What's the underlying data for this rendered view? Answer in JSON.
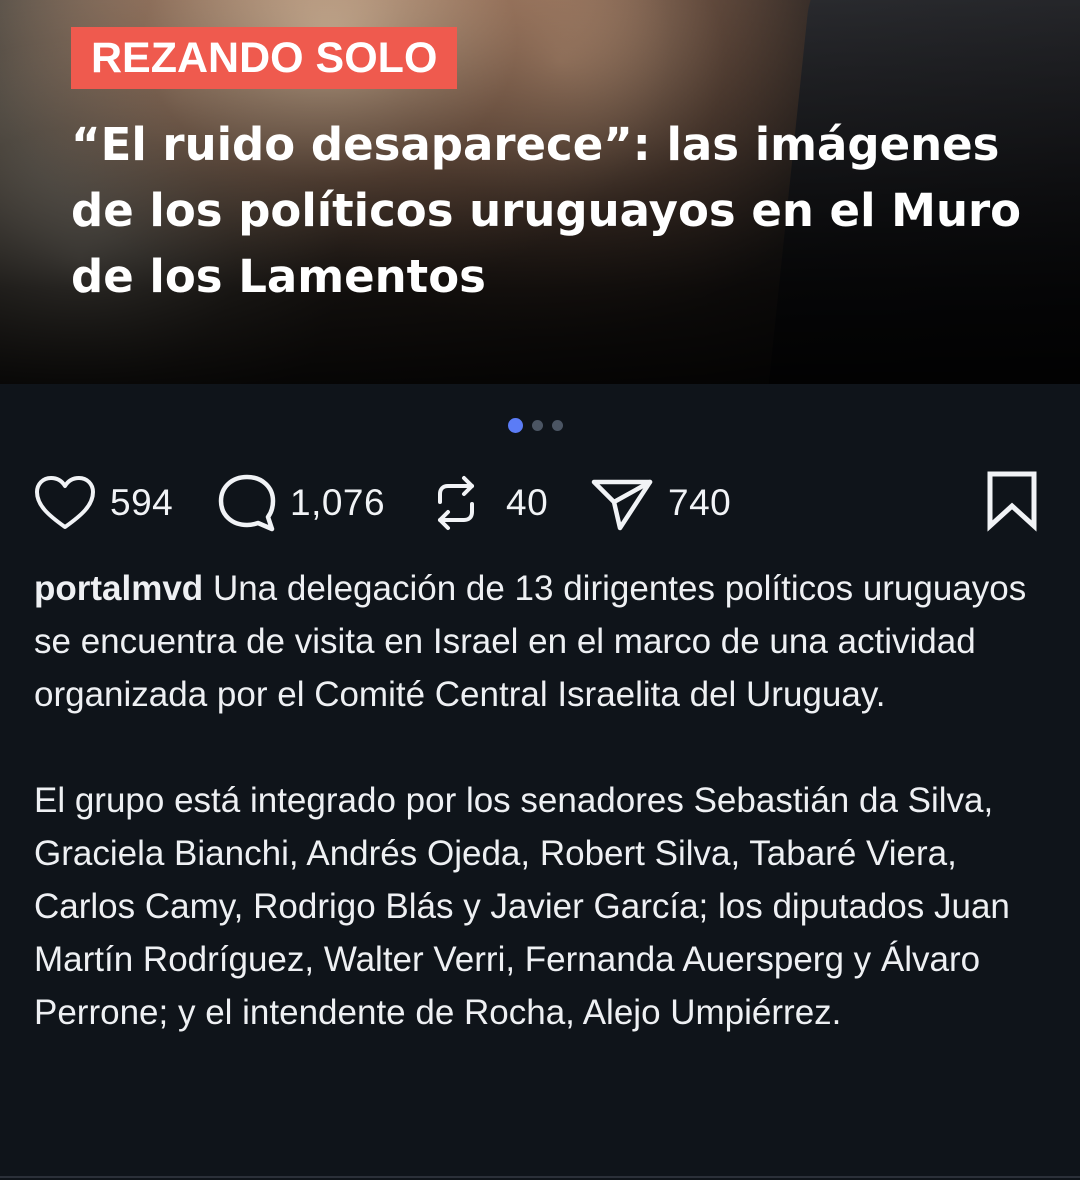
{
  "post": {
    "tag": "REZANDO SOLO",
    "headline": "“El ruido desaparece”: las imágenes de los políticos uruguayos en el Muro de los Lamentos",
    "carousel": {
      "total": 3,
      "active_index": 0
    }
  },
  "actions": {
    "likes": "594",
    "comments": "1,076",
    "reposts": "40",
    "shares": "740"
  },
  "caption": {
    "username": "portalmvd",
    "paragraph1": "Una delegación de 13 dirigentes políticos uruguayos se encuentra de visita en Israel en el marco de una actividad organizada por el Comité Central Israelita del Uruguay.",
    "paragraph2": "El grupo está integrado por los senadores Sebastián da Silva, Graciela Bianchi, Andrés Ojeda, Robert Silva, Tabaré Viera, Carlos Camy, Rodrigo Blás y Javier García; los diputados Juan Martín Rodríguez, Walter Verri, Fernanda Auersperg y Álvaro Perrone; y el intendente de Rocha, Alejo Umpiérrez."
  },
  "colors": {
    "tag_background": "#ef5a4e",
    "background": "#0f141a",
    "active_dot": "#5b7cf6"
  },
  "icons": [
    "heart-icon",
    "comment-icon",
    "repost-icon",
    "send-icon",
    "bookmark-icon"
  ]
}
